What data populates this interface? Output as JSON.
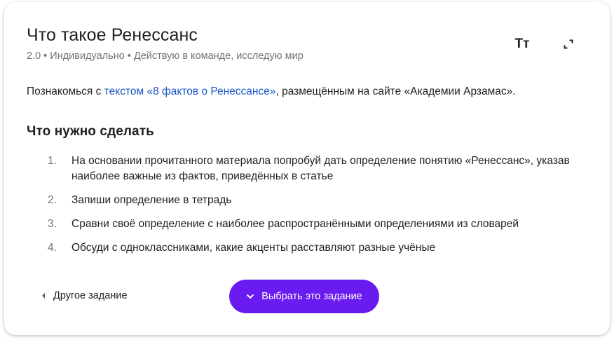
{
  "task": {
    "title": "Что такое Ренессанс",
    "meta": "2.0 • Индивидуально • Действую в команде, исследую мир",
    "intro_before": "Познакомься с ",
    "intro_link": "текстом «8 фактов о Ренессансе»",
    "intro_after": ", размещённым на сайте «Академии Арзамас».",
    "section_title": "Что нужно сделать",
    "steps": [
      {
        "num": "1.",
        "text": "На основании прочитанного материала попробуй дать определение понятию «Ренессанс», указав наиболее важные из фактов, приведённых в статье"
      },
      {
        "num": "2.",
        "text": "Запиши определение в тетрадь"
      },
      {
        "num": "3.",
        "text": "Сравни своё определение с наиболее распространёнными определениями из словарей"
      },
      {
        "num": "4.",
        "text": "Обсуди с одноклассниками, какие акценты расставляют разные учёные"
      }
    ]
  },
  "toolbar": {
    "font_size_icon": "text-size-icon",
    "font_size_label": "Тт",
    "expand_icon": "expand-icon"
  },
  "footer": {
    "other_label": "Другое задание",
    "other_icon": "caret-left-icon",
    "choose_label": "Выбрать это задание",
    "choose_icon": "chevron-down-icon"
  },
  "colors": {
    "accent": "#6a1cf0",
    "link": "#1a56c4"
  }
}
